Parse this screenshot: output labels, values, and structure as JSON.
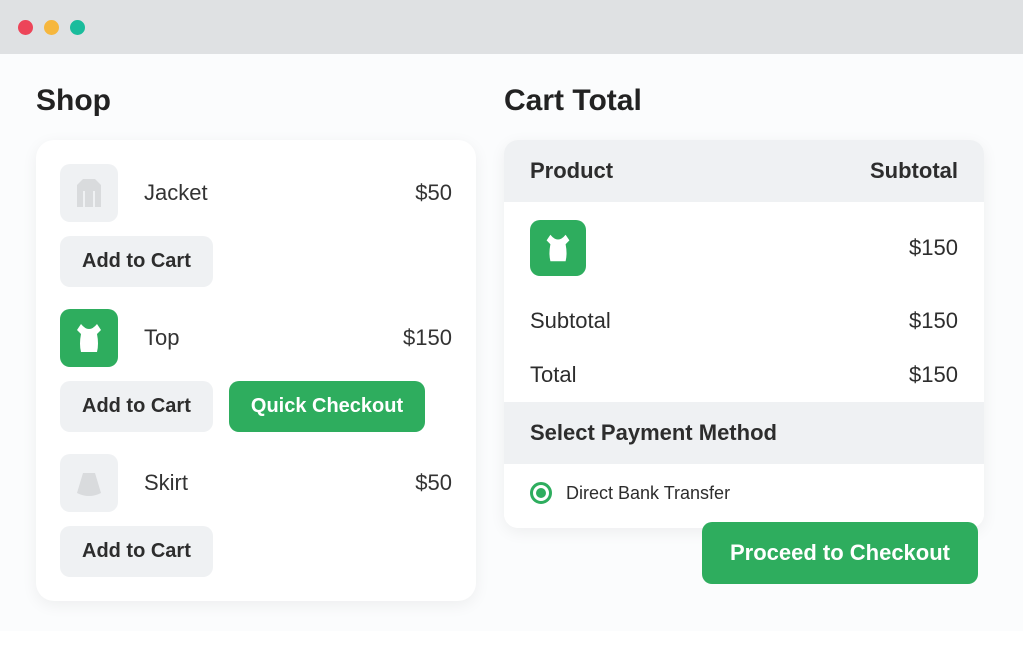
{
  "titlebar": {
    "dots": [
      "#ed4559",
      "#f6b73e",
      "#1abc9c"
    ]
  },
  "shop": {
    "title": "Shop",
    "add_to_cart_label": "Add to Cart",
    "quick_checkout_label": "Quick Checkout",
    "products": [
      {
        "name": "Jacket",
        "price": "$50",
        "thumb": "jacket",
        "thumb_style": "grey",
        "selected": false
      },
      {
        "name": "Top",
        "price": "$150",
        "thumb": "top",
        "thumb_style": "green",
        "selected": true
      },
      {
        "name": "Skirt",
        "price": "$50",
        "thumb": "skirt",
        "thumb_style": "grey",
        "selected": false
      }
    ]
  },
  "cart": {
    "title": "Cart Total",
    "column_product": "Product",
    "column_subtotal": "Subtotal",
    "items": [
      {
        "thumb": "top",
        "thumb_style": "green",
        "subtotal": "$150"
      }
    ],
    "subtotal_label": "Subtotal",
    "subtotal_value": "$150",
    "total_label": "Total",
    "total_value": "$150",
    "payment_section_title": "Select Payment Method",
    "payment_options": [
      {
        "label": "Direct Bank Transfer",
        "selected": true
      }
    ],
    "proceed_label": "Proceed to Checkout"
  }
}
